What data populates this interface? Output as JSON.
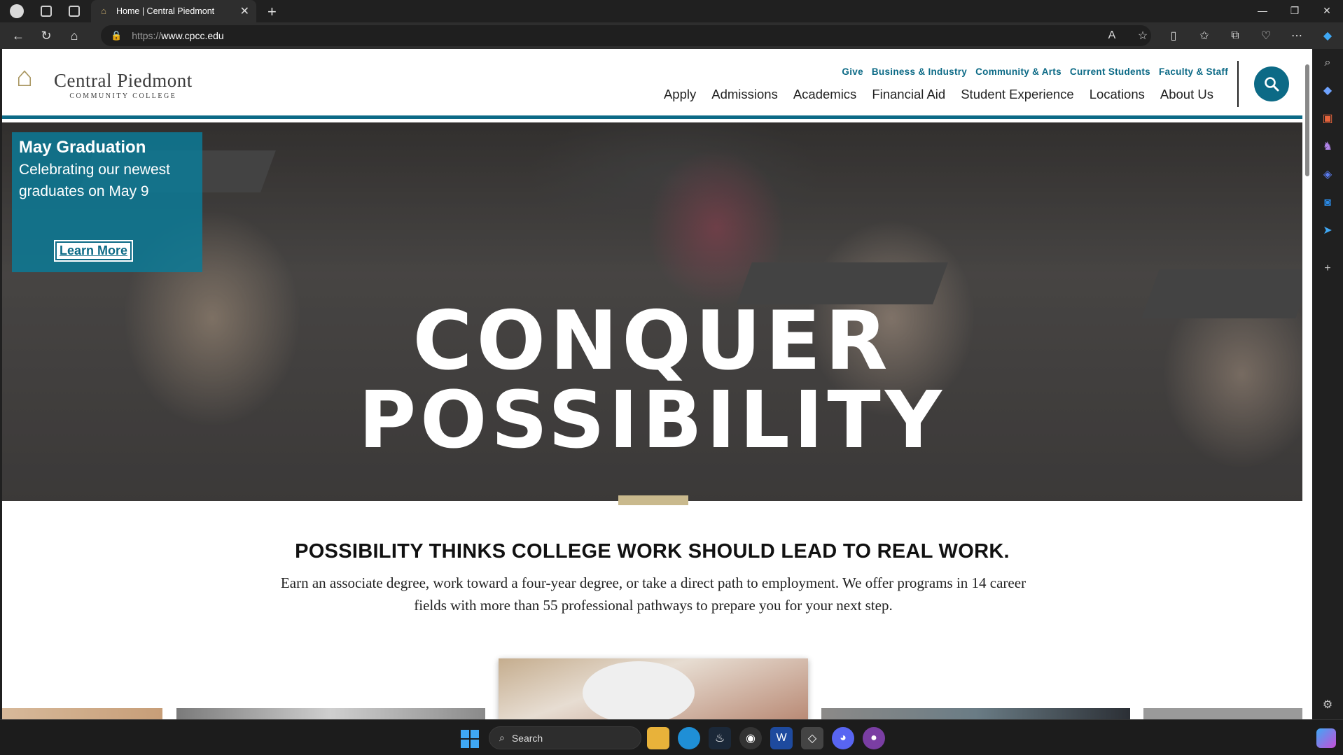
{
  "browser": {
    "tab_title": "Home | Central Piedmont",
    "new_tab": "+",
    "url_proto": "https://",
    "url_host": "www.cpcc.edu"
  },
  "header": {
    "logo_name": "Central Piedmont",
    "logo_sub": "COMMUNITY COLLEGE",
    "utility_nav": [
      "Give",
      "Business & Industry",
      "Community & Arts",
      "Current Students",
      "Faculty & Staff"
    ],
    "main_nav": [
      "Apply",
      "Admissions",
      "Academics",
      "Financial Aid",
      "Student Experience",
      "Locations",
      "About Us"
    ]
  },
  "promo": {
    "title": "May Graduation",
    "subtitle": "Celebrating our newest graduates on May 9",
    "button": "Learn More"
  },
  "hero": {
    "line1": "CONQUER",
    "line2": "POSSIBILITY"
  },
  "intro": {
    "heading": "POSSIBILITY THINKS COLLEGE WORK SHOULD LEAD TO REAL WORK.",
    "body": "Earn an associate degree, work toward a four-year degree, or take a direct path to employment. We offer programs in 14 career fields with more than 55 professional pathways to prepare you for your next step."
  },
  "taskbar": {
    "search_placeholder": "Search"
  },
  "colors": {
    "brand_teal": "#0c6a86",
    "gold": "#c9b98d",
    "logo_gold": "#a8955f"
  }
}
